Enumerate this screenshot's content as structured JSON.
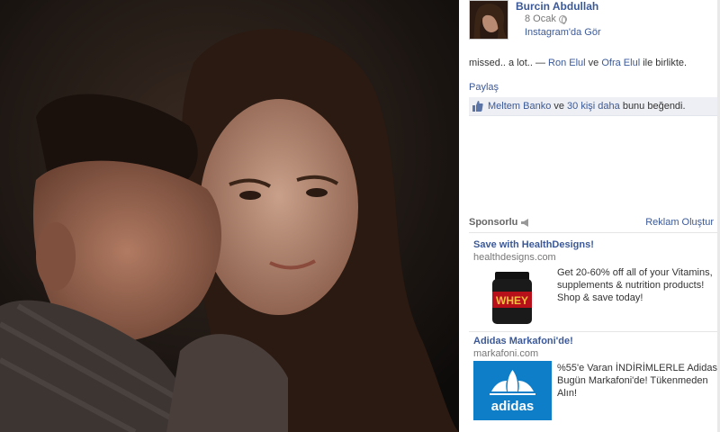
{
  "author": {
    "name": "Burcin Abdullah",
    "date": "8 Ocak",
    "via": "Instagram'da Gör"
  },
  "post": {
    "caption_text": "missed.. a lot.. — ",
    "tag_1": "Ron Elul",
    "connector": " ve ",
    "tag_2": "Ofra Elul",
    "suffix": " ile birlikte."
  },
  "actions": {
    "share_label": "Paylaş"
  },
  "likes": {
    "name": "Meltem Banko",
    "joiner": " ve ",
    "others": "30 kişi daha",
    "tail": " bunu beğendi."
  },
  "sponsored": {
    "label": "Sponsorlu",
    "create_ad": "Reklam Oluştur",
    "ads": [
      {
        "title": "Save with HealthDesigns!",
        "domain": "healthdesigns.com",
        "body": "Get 20-60% off all of your Vitamins, supplements & nutrition products! Shop & save today!",
        "image_text": "WHEY"
      },
      {
        "title": "Adidas Markafoni'de!",
        "domain": "markafoni.com",
        "body": "%55'e Varan İNDİRİMLERLE Adidas Bugün Markafoni'de! Tükenmeden Alın!",
        "image_text": "adidas"
      }
    ]
  },
  "colors": {
    "link": "#3b5998",
    "likes_bg": "#edeff4",
    "adidas_blue": "#0e7ec9"
  }
}
